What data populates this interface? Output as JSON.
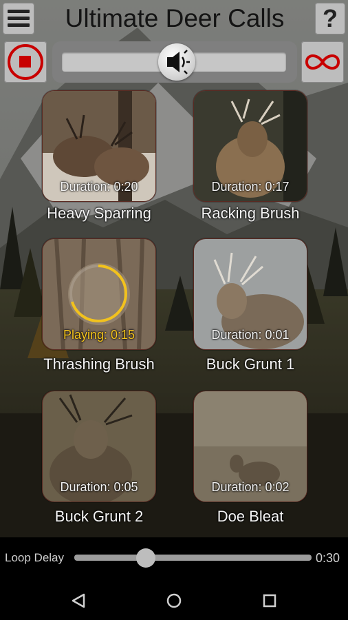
{
  "header": {
    "title": "Ultimate Deer Calls",
    "help_label": "?",
    "menu_icon": "hamburger-menu-icon",
    "stop_icon": "stop-icon",
    "volume_icon": "speaker-icon",
    "loop_icon": "infinity-loop-icon",
    "volume_level": 0.47
  },
  "sounds": [
    {
      "name": "Heavy Sparring",
      "status": "Duration: 0:20",
      "playing": false
    },
    {
      "name": "Racking Brush",
      "status": "Duration: 0:17",
      "playing": false
    },
    {
      "name": "Thrashing Brush",
      "status": "Playing: 0:15",
      "playing": true,
      "progress": 0.7
    },
    {
      "name": "Buck Grunt 1",
      "status": "Duration: 0:01",
      "playing": false
    },
    {
      "name": "Buck Grunt 2",
      "status": "Duration: 0:05",
      "playing": false
    },
    {
      "name": "Doe Bleat",
      "status": "Duration: 0:02",
      "playing": false
    }
  ],
  "loop_delay": {
    "label": "Loop Delay",
    "value": "0:30",
    "level": 0.3
  },
  "nav": {
    "back_icon": "back-triangle-icon",
    "home_icon": "home-circle-icon",
    "recents_icon": "recents-square-icon"
  },
  "colors": {
    "accent_red": "#c80000",
    "playing_yellow": "#f2c21d",
    "header_button": "#bdbdbd"
  }
}
